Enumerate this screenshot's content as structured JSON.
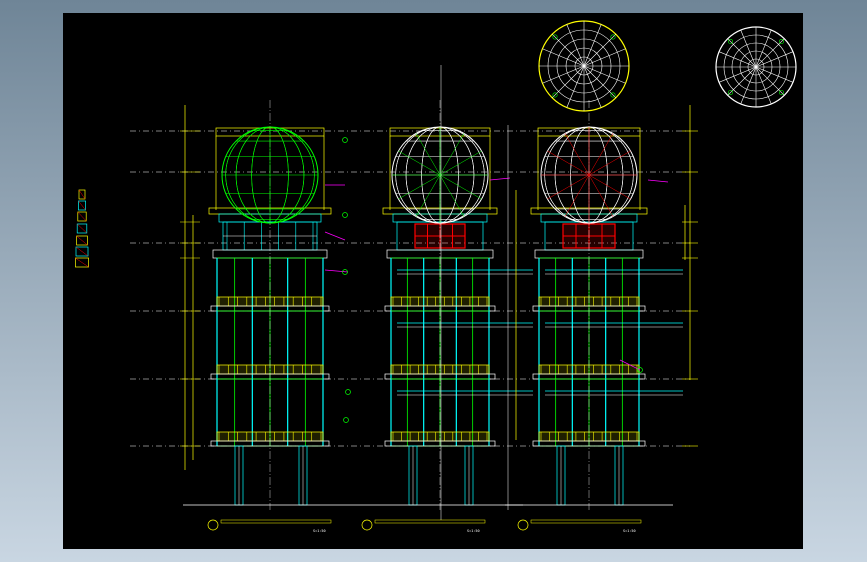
{
  "colors": {
    "background_gradient": [
      "#6f8597",
      "#c9d6e2"
    ],
    "canvas": "#000000",
    "yellow": "#ffff00",
    "green": "#00ff00",
    "cyan": "#00ffff",
    "white": "#ffffff",
    "red": "#ff0000",
    "magenta": "#ff00ff",
    "blue": "#0000ff"
  },
  "drawing": {
    "views": [
      {
        "title": "",
        "scale": "S=1:50"
      },
      {
        "title": "",
        "scale": "S=1:50"
      },
      {
        "title": "",
        "scale": "S=1:50"
      }
    ],
    "dome_plans": [
      {
        "kind": "dome-plan-colored"
      },
      {
        "kind": "dome-plan-mono"
      }
    ]
  }
}
